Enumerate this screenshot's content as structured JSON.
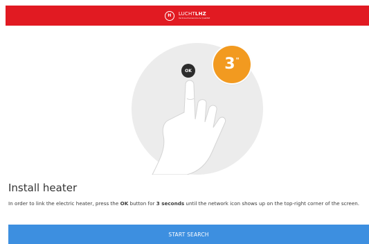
{
  "colors": {
    "header_red": "#e11a22",
    "timer_orange": "#f29a20",
    "button_blue": "#3d8fe0"
  },
  "header": {
    "logo_mark": "H",
    "brand_prefix": "LUCHT",
    "brand_suffix": "LHZ",
    "brand_tagline": "Verbraucherservice & Qualität"
  },
  "illustration": {
    "timer_value": "3",
    "timer_unit": "\"",
    "ok_label": "OK"
  },
  "content": {
    "title": "Install heater",
    "desc_part1": "In order to link the electric heater, press the ",
    "desc_ok": "OK",
    "desc_part2": " button for ",
    "desc_seconds": "3 seconds",
    "desc_part3": " until the network icon shows up on the top-right corner of the screen."
  },
  "actions": {
    "start_search_label": "START SEARCH"
  }
}
